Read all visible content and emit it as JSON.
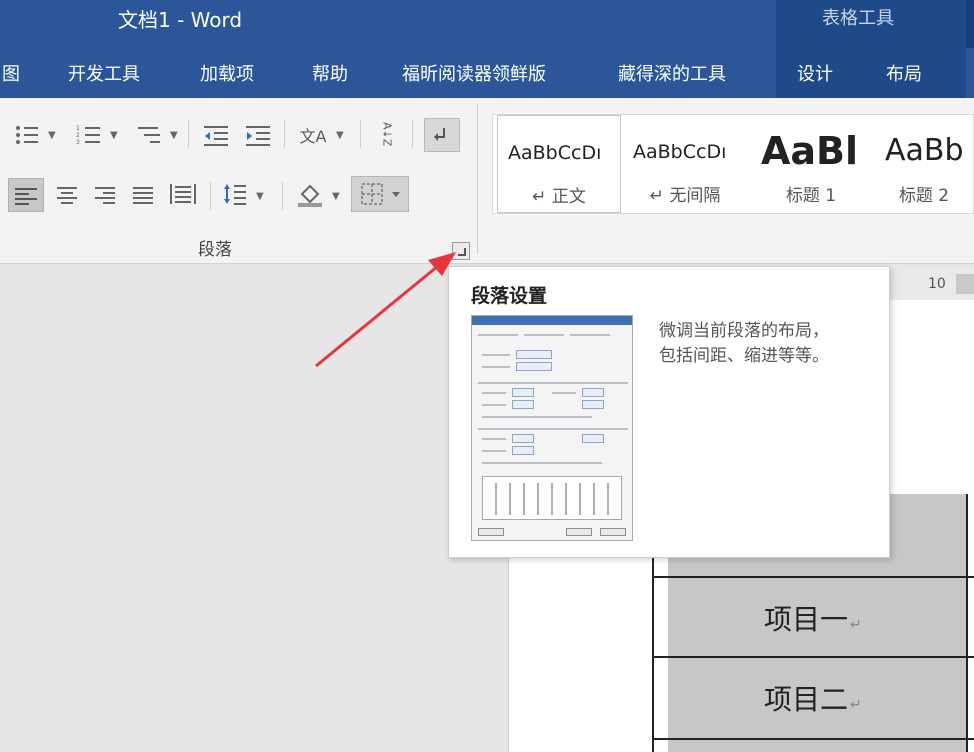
{
  "window": {
    "title": "文档1  -  Word",
    "context_group": "表格工具"
  },
  "tabs": [
    {
      "label": "图"
    },
    {
      "label": "开发工具"
    },
    {
      "label": "加载项"
    },
    {
      "label": "帮助"
    },
    {
      "label": "福昕阅读器领鲜版"
    },
    {
      "label": "藏得深的工具"
    },
    {
      "label": "设计"
    },
    {
      "label": "布局"
    }
  ],
  "ribbon": {
    "paragraph_group_label": "段落",
    "icons": {
      "bullets": "bullets-icon",
      "numbering": "numbering-icon",
      "multilevel": "multilevel-list-icon",
      "decrease_indent": "decrease-indent-icon",
      "increase_indent": "increase-indent-icon",
      "chinese_layout": "chinese-layout-icon",
      "sort": "sort-icon",
      "show_marks": "show-marks-icon",
      "align_left": "align-left-icon",
      "center": "align-center-icon",
      "align_right": "align-right-icon",
      "justify": "justify-icon",
      "distributed": "distributed-icon",
      "line_spacing": "line-spacing-icon",
      "shading": "shading-icon",
      "borders": "borders-icon",
      "launcher": "dialog-launcher-icon"
    },
    "glyphs": {
      "sort": "A↓Z",
      "chinese_layout": "文A",
      "shading": "◇"
    },
    "styles": [
      {
        "sample": "AaBbCcDı",
        "name": "↵ 正文"
      },
      {
        "sample": "AaBbCcDı",
        "name": "↵ 无间隔"
      },
      {
        "sample": "AaBl",
        "name": "标题 1"
      },
      {
        "sample": "AaBb",
        "name": "标题 2"
      }
    ]
  },
  "tooltip": {
    "title": "段落设置",
    "description_line1": "微调当前段落的布局，",
    "description_line2": "包括间距、缩进等等。"
  },
  "document": {
    "ruler_value": "10",
    "table_rows": [
      {
        "text": "项目一",
        "mark": "↵"
      },
      {
        "text": "项目二",
        "mark": "↵"
      }
    ]
  },
  "colors": {
    "title_bar": "#2b579a",
    "context_tab": "#1e4a8a",
    "arrow": "#e8343a"
  }
}
